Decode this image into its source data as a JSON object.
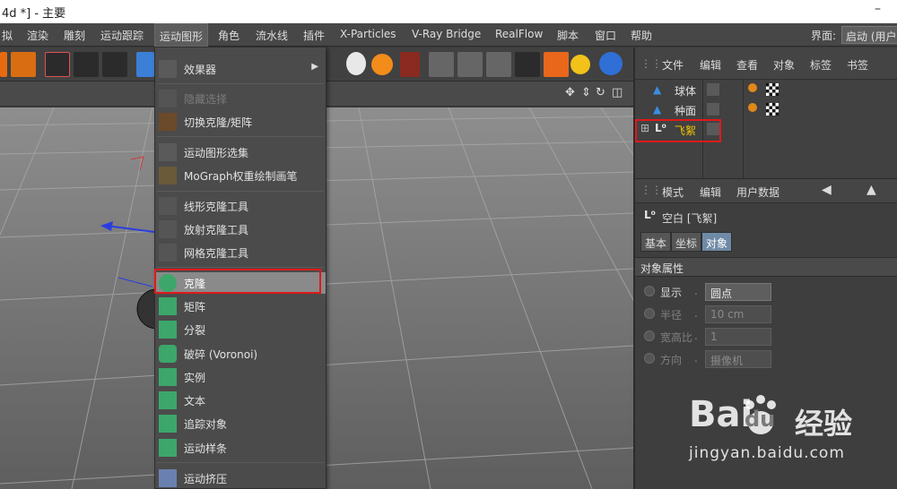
{
  "window": {
    "title": "4d *] - 主要",
    "minimize_glyph": "–"
  },
  "menubar": {
    "items": [
      "拟",
      "渲染",
      "雕刻",
      "运动跟踪",
      "运动图形",
      "角色",
      "流水线",
      "插件",
      "X-Particles",
      "V-Ray Bridge",
      "RealFlow",
      "脚本",
      "窗口",
      "帮助"
    ],
    "active_index": 4,
    "layout_label": "界面:",
    "layout_value": "启动 (用户"
  },
  "mograph_menu": {
    "items": [
      {
        "label": "效果器",
        "icon": "effector-icon",
        "submenu": true,
        "disabled": false
      },
      {
        "label": "隐藏选择",
        "icon": "hide-selection-icon",
        "disabled": true
      },
      {
        "label": "切换克隆/矩阵",
        "icon": "toggle-clone-matrix-icon",
        "disabled": false
      },
      {
        "label": "运动图形选集",
        "icon": "mograph-selection-icon",
        "disabled": false
      },
      {
        "label": "MoGraph权重绘制画笔",
        "icon": "weight-paint-brush-icon",
        "disabled": false
      },
      {
        "label": "线形克隆工具",
        "icon": "linear-clone-tool-icon",
        "disabled": false
      },
      {
        "label": "放射克隆工具",
        "icon": "radial-clone-tool-icon",
        "disabled": false
      },
      {
        "label": "网格克隆工具",
        "icon": "grid-clone-tool-icon",
        "disabled": false
      },
      {
        "label": "克隆",
        "icon": "cloner-icon",
        "disabled": false,
        "highlight": true
      },
      {
        "label": "矩阵",
        "icon": "matrix-icon",
        "disabled": false
      },
      {
        "label": "分裂",
        "icon": "fracture-icon",
        "disabled": false
      },
      {
        "label": "破碎 (Voronoi)",
        "icon": "voronoi-fracture-icon",
        "disabled": false
      },
      {
        "label": "实例",
        "icon": "instance-icon",
        "disabled": false
      },
      {
        "label": "文本",
        "icon": "text-icon",
        "disabled": false
      },
      {
        "label": "追踪对象",
        "icon": "tracer-icon",
        "disabled": false
      },
      {
        "label": "运动样条",
        "icon": "mospline-icon",
        "disabled": false
      },
      {
        "label": "运动挤压",
        "icon": "moextrude-icon",
        "disabled": false
      }
    ],
    "submenu_arrow": "▶"
  },
  "object_manager": {
    "menu": [
      "文件",
      "编辑",
      "查看",
      "对象",
      "标签",
      "书签"
    ],
    "objects": [
      {
        "name": "球体",
        "icon": "sphere-icon",
        "expand": "",
        "selected": false
      },
      {
        "name": "种面",
        "icon": "plane-icon",
        "expand": "",
        "selected": false
      },
      {
        "name": "飞絮",
        "icon": "null-object-icon",
        "expand": "⊞",
        "selected": true
      }
    ]
  },
  "attribute_manager": {
    "menu": [
      "模式",
      "编辑",
      "用户数据"
    ],
    "title": "空白 [飞絮]",
    "tabs": [
      "基本",
      "坐标",
      "对象"
    ],
    "active_tab": 2,
    "section": "对象属性",
    "props": [
      {
        "label": "显示",
        "value": "圆点",
        "type": "dropdown",
        "enabled": true
      },
      {
        "label": "半径",
        "value": "10 cm",
        "type": "number",
        "enabled": false
      },
      {
        "label": "宽高比",
        "value": "1",
        "type": "number",
        "enabled": false
      },
      {
        "label": "方向",
        "value": "摄像机",
        "type": "dropdown",
        "enabled": false
      }
    ]
  },
  "watermark": {
    "brand": "Bai",
    "brand2": "du",
    "cn": "经验",
    "url": "jingyan.baidu.com"
  },
  "colors": {
    "highlight_box": "#e0191a",
    "active_tab": "#6f8aa6",
    "selected_object": "#f0c400"
  }
}
